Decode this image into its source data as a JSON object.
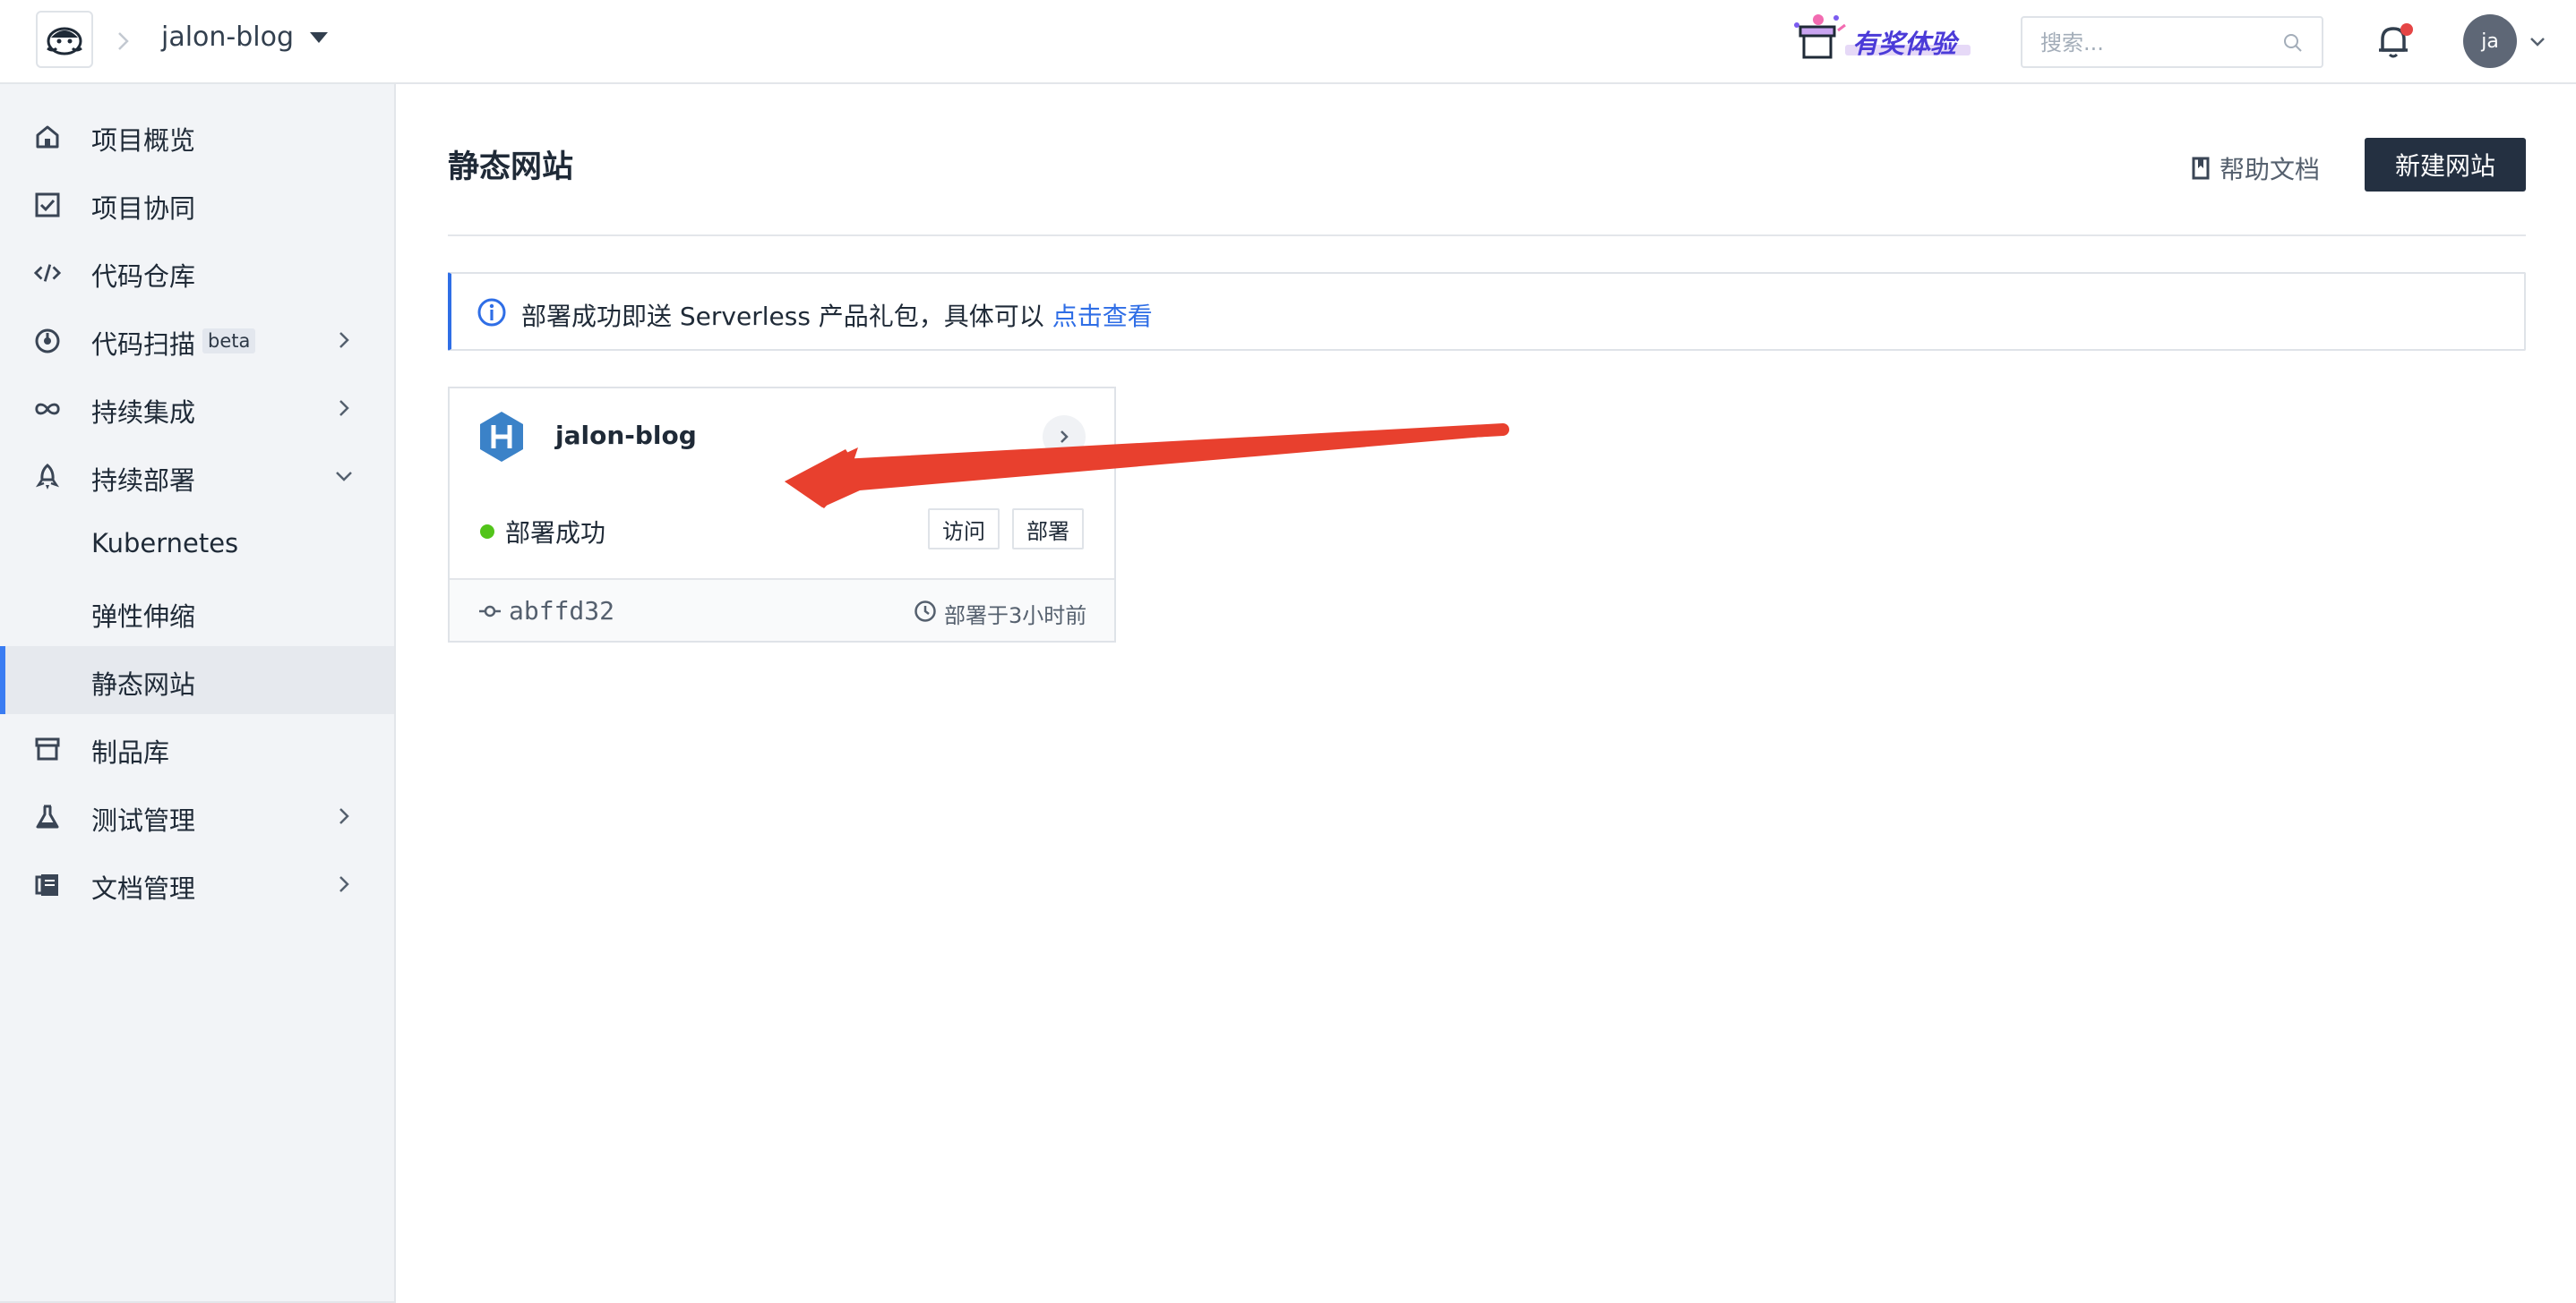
{
  "header": {
    "project_name": "jalon-blog",
    "promo_label": "有奖体验",
    "search_placeholder": "搜索...",
    "user_initials": "ja"
  },
  "sidebar": {
    "items": [
      {
        "label": "项目概览",
        "icon": "home-icon"
      },
      {
        "label": "项目协同",
        "icon": "checkbox-icon"
      },
      {
        "label": "代码仓库",
        "icon": "code-icon"
      },
      {
        "label": "代码扫描",
        "icon": "scan-icon",
        "badge": "beta",
        "expandable": true
      },
      {
        "label": "持续集成",
        "icon": "infinity-icon",
        "expandable": true
      },
      {
        "label": "持续部署",
        "icon": "rocket-icon",
        "expanded": true
      },
      {
        "label": "Kubernetes",
        "sub": true
      },
      {
        "label": "弹性伸缩",
        "sub": true
      },
      {
        "label": "静态网站",
        "sub": true,
        "active": true
      },
      {
        "label": "制品库",
        "icon": "archive-icon"
      },
      {
        "label": "测试管理",
        "icon": "flask-icon",
        "expandable": true
      },
      {
        "label": "文档管理",
        "icon": "book-icon",
        "expandable": true
      }
    ]
  },
  "main": {
    "title": "静态网站",
    "help_label": "帮助文档",
    "new_button": "新建网站",
    "notice": {
      "text": "部署成功即送 Serverless 产品礼包，具体可以 ",
      "link": "点击查看"
    },
    "site_card": {
      "name": "jalon-blog",
      "status": "部署成功",
      "visit_label": "访问",
      "deploy_label": "部署",
      "commit": "abffd32",
      "deployed_at": "部署于3小时前"
    }
  },
  "colors": {
    "accent": "#3a7cf2",
    "link": "#2f6ee6",
    "success": "#52c41a",
    "primary_button": "#243041",
    "annotation_arrow": "#e8402e"
  }
}
